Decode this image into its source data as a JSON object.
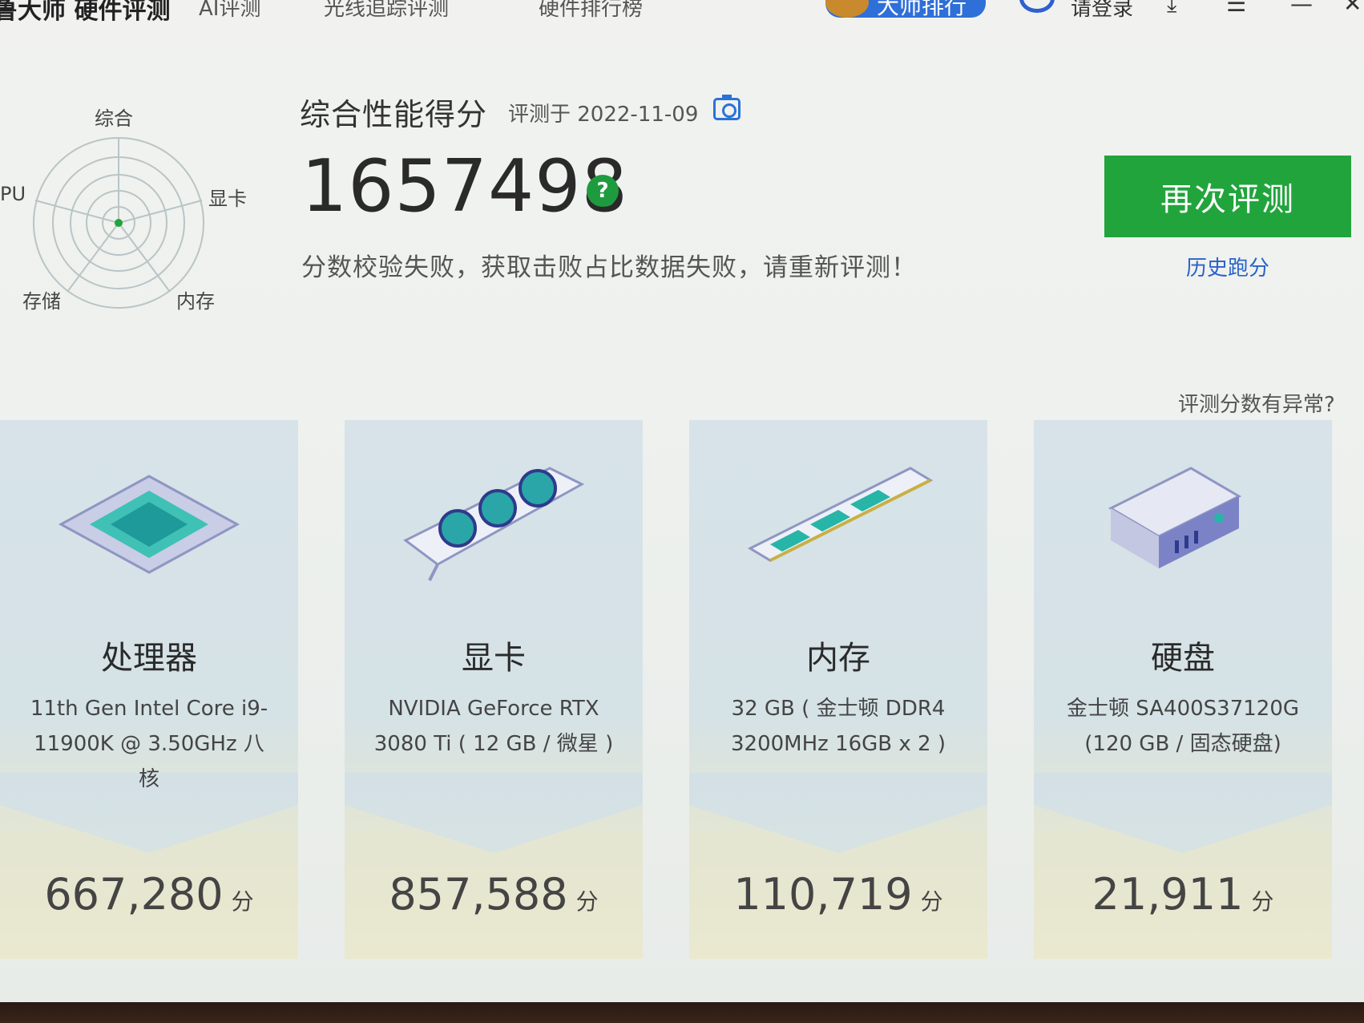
{
  "topbar": {
    "brand": "鲁大师 硬件评测",
    "nav": [
      "AI评测",
      "光线追踪评测",
      "硬件排行榜"
    ],
    "rank_button": "大师排行",
    "login": "请登录",
    "window_icons": [
      "download-icon",
      "menu-icon",
      "minimize-icon",
      "close-icon"
    ]
  },
  "radar": {
    "labels": {
      "top": "综合",
      "left": "PU",
      "right": "显卡",
      "bottom_left": "存储",
      "bottom_right": "内存"
    }
  },
  "score": {
    "title": "综合性能得分",
    "date": "评测于 2022-11-09",
    "value": "1657498",
    "help": "?",
    "message": "分数校验失败，获取击败占比数据失败，请重新评测！"
  },
  "actions": {
    "retest": "再次评测",
    "history": "历史跑分",
    "abnormal": "评测分数有异常?"
  },
  "cards": [
    {
      "name": "处理器",
      "model": "11th Gen Intel Core i9-11900K @ 3.50GHz 八核",
      "score": "667,280",
      "unit": "分",
      "icon": "cpu-icon"
    },
    {
      "name": "显卡",
      "model": "NVIDIA GeForce RTX 3080 Ti ( 12 GB / 微星 )",
      "score": "857,588",
      "unit": "分",
      "icon": "gpu-icon"
    },
    {
      "name": "内存",
      "model": "32 GB ( 金士顿 DDR4 3200MHz 16GB x 2 )",
      "score": "110,719",
      "unit": "分",
      "icon": "ram-icon"
    },
    {
      "name": "硬盘",
      "model": "金士顿 SA400S37120G (120 GB / 固态硬盘)",
      "score": "21,911",
      "unit": "分",
      "icon": "disk-icon"
    }
  ],
  "colors": {
    "accent_green": "#22a43c",
    "link_blue": "#2a62c8",
    "teal": "#27b5a8"
  }
}
